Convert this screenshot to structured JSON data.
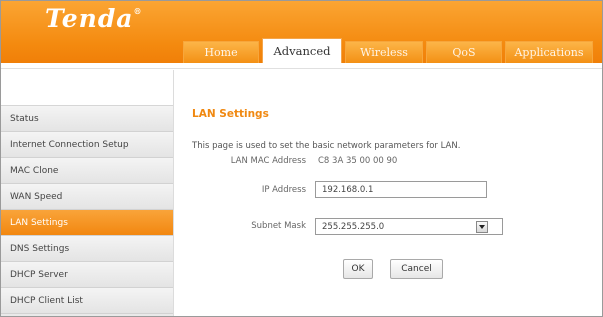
{
  "brand": {
    "name": "Tenda",
    "mark": "®"
  },
  "tabs": [
    {
      "label": "Home",
      "active": false
    },
    {
      "label": "Advanced",
      "active": true
    },
    {
      "label": "Wireless",
      "active": false
    },
    {
      "label": "QoS",
      "active": false
    },
    {
      "label": "Applications",
      "active": false
    }
  ],
  "sidebar": {
    "items": [
      {
        "label": "Status"
      },
      {
        "label": "Internet Connection Setup"
      },
      {
        "label": "MAC Clone"
      },
      {
        "label": "WAN Speed"
      },
      {
        "label": "LAN Settings",
        "active": true
      },
      {
        "label": "DNS Settings"
      },
      {
        "label": "DHCP Server"
      },
      {
        "label": "DHCP Client List"
      }
    ]
  },
  "main": {
    "title": "LAN Settings",
    "description": "This page is used to set the basic network parameters for LAN.",
    "mac_label": "LAN MAC Address",
    "mac_value": "C8 3A 35 00 00 90",
    "ip_label": "IP Address",
    "ip_value": "192.168.0.1",
    "mask_label": "Subnet Mask",
    "mask_value": "255.255.255.0",
    "ok_label": "OK",
    "cancel_label": "Cancel"
  },
  "colors": {
    "accent": "#f48a0f",
    "active_tab_text": "#333333",
    "title": "#f08810"
  }
}
